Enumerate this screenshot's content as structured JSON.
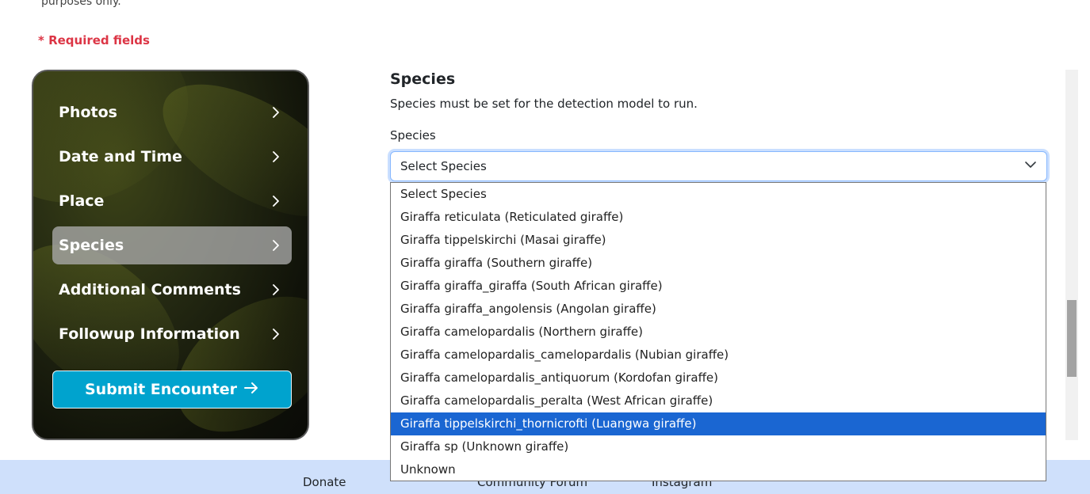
{
  "intro": {
    "cut_text": "purposes only."
  },
  "required_note": "* Required fields",
  "sidebar": {
    "items": [
      {
        "label": "Photos",
        "active": false
      },
      {
        "label": "Date and Time",
        "active": false
      },
      {
        "label": "Place",
        "active": false
      },
      {
        "label": "Species",
        "active": true
      },
      {
        "label": "Additional Comments",
        "active": false
      },
      {
        "label": "Followup Information",
        "active": false
      }
    ],
    "submit_label": "Submit Encounter",
    "submit_icon": "arrow-right-icon"
  },
  "species_section": {
    "title": "Species",
    "description": "Species must be set for the detection model to run.",
    "field_label": "Species",
    "selected_value": "Select Species",
    "options": [
      "Select Species",
      "Giraffa reticulata (Reticulated giraffe)",
      "Giraffa tippelskirchi (Masai giraffe)",
      "Giraffa giraffa (Southern giraffe)",
      "Giraffa giraffa_giraffa (South African giraffe)",
      "Giraffa giraffa_angolensis (Angolan giraffe)",
      "Giraffa camelopardalis (Northern giraffe)",
      "Giraffa camelopardalis_camelopardalis (Nubian giraffe)",
      "Giraffa camelopardalis_antiquorum (Kordofan giraffe)",
      "Giraffa camelopardalis_peralta (West African giraffe)",
      "Giraffa tippelskirchi_thornicrofti (Luangwa giraffe)",
      "Giraffa sp (Unknown giraffe)",
      "Unknown"
    ],
    "highlighted_option": "Giraffa tippelskirchi_thornicrofti (Luangwa giraffe)"
  },
  "footer": {
    "links": [
      "Donate",
      "Community Forum",
      "Instagram"
    ]
  },
  "colors": {
    "accent": "#00a3ce",
    "required": "#dc3545",
    "highlight": "#1a66d2",
    "footer_bg": "#cfe0fb"
  }
}
